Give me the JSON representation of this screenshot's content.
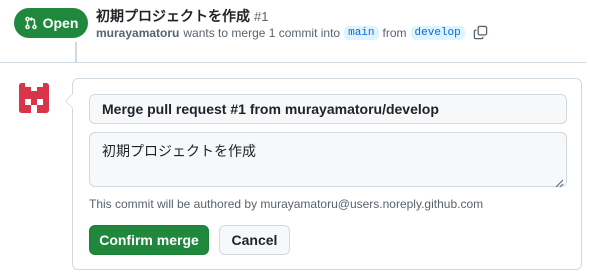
{
  "pull_request": {
    "state_label": "Open",
    "state_icon": "git-pull-request-icon",
    "title": "初期プロジェクトを作成",
    "number": "#1",
    "author": "murayamatoru",
    "meta_text": "wants to merge 1 commit into",
    "base_branch": "main",
    "from_text": "from",
    "head_branch": "develop",
    "copy_icon": "copy-icon"
  },
  "merge_form": {
    "commit_title": "Merge pull request #1 from murayamatoru/develop",
    "commit_body": "初期プロジェクトを作成",
    "author_note": "This commit will be authored by murayamatoru@users.noreply.github.com",
    "confirm_label": "Confirm merge",
    "cancel_label": "Cancel"
  },
  "colors": {
    "accent_green": "#1f883d",
    "border": "#d1d9e0",
    "muted_text": "#59636e",
    "branch_blue": "#0969da",
    "branch_bg": "#ddf4ff",
    "avatar_red": "#d8344a"
  }
}
